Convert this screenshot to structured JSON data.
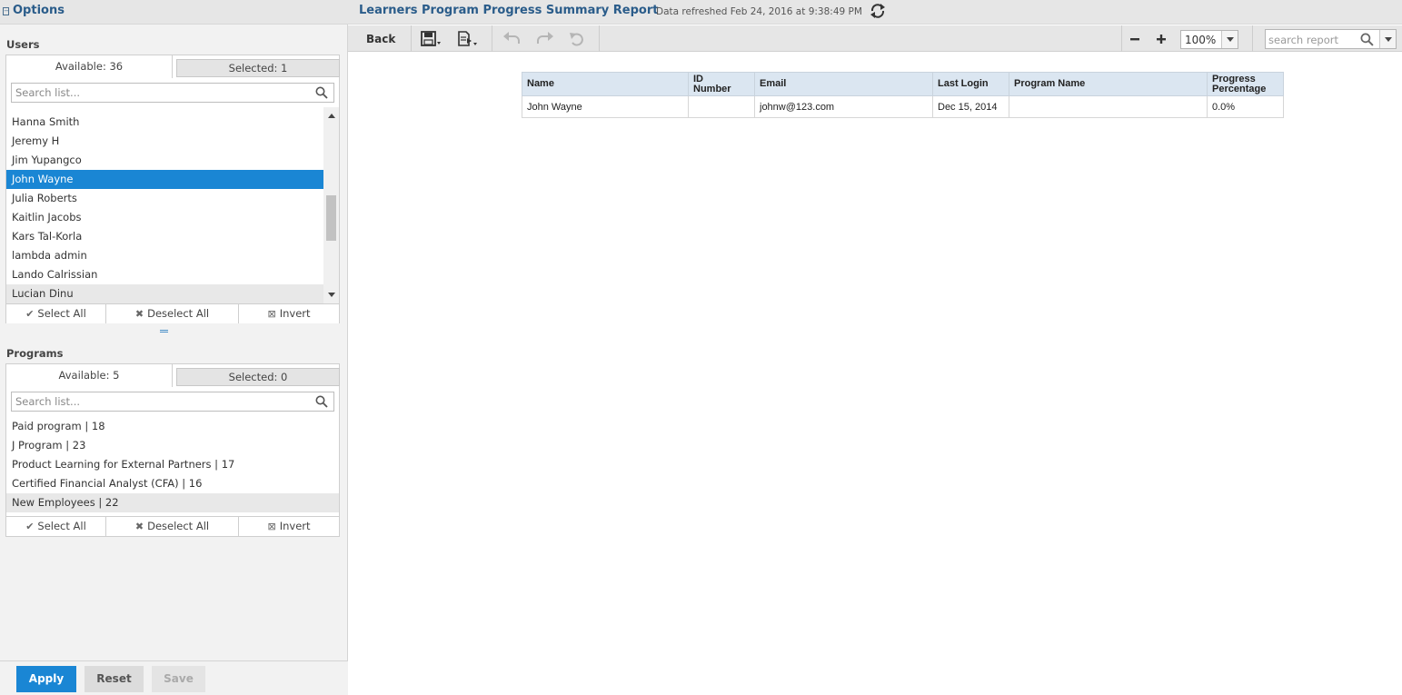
{
  "options": {
    "title": "Options",
    "users": {
      "label": "Users",
      "tab_available": "Available: 36",
      "tab_selected": "Selected: 1",
      "search_placeholder": "Search list...",
      "items": [
        "Hanna Smith",
        "Jeremy H",
        "Jim Yupangco",
        "John Wayne",
        "Julia Roberts",
        "Kaitlin Jacobs",
        "Kars Tal-Korla",
        "lambda admin",
        "Lando Calrissian",
        "Lucian Dinu"
      ],
      "selected_item": "John Wayne",
      "select_all": "Select All",
      "deselect_all": "Deselect All",
      "invert": "Invert"
    },
    "programs": {
      "label": "Programs",
      "tab_available": "Available: 5",
      "tab_selected": "Selected: 0",
      "search_placeholder": "Search list...",
      "items": [
        "Paid program | 18",
        "J Program | 23",
        "Product Learning for External Partners | 17",
        "Certified Financial Analyst (CFA) | 16",
        "New Employees | 22"
      ],
      "select_all": "Select All",
      "deselect_all": "Deselect All",
      "invert": "Invert"
    },
    "buttons": {
      "apply": "Apply",
      "reset": "Reset",
      "save": "Save"
    }
  },
  "header": {
    "report_title": "Learners Program Progress Summary Report",
    "refreshed": "Data refreshed Feb 24, 2016 at 9:38:49 PM"
  },
  "toolbar": {
    "back": "Back",
    "zoom": "100%",
    "search_placeholder": "search report"
  },
  "table": {
    "columns": [
      {
        "line1": "Name",
        "line2": ""
      },
      {
        "line1": "ID",
        "line2": "Number"
      },
      {
        "line1": "Email",
        "line2": ""
      },
      {
        "line1": "Last Login",
        "line2": ""
      },
      {
        "line1": "Program Name",
        "line2": ""
      },
      {
        "line1": "Progress",
        "line2": "Percentage"
      }
    ],
    "rows": [
      [
        "John Wayne",
        "",
        "johnw@123.com",
        "Dec 15, 2014",
        "",
        "0.0%"
      ]
    ]
  },
  "colors": {
    "accent": "#1a86d4",
    "title": "#2a5c8a",
    "header_bg": "#dbe6f1"
  }
}
